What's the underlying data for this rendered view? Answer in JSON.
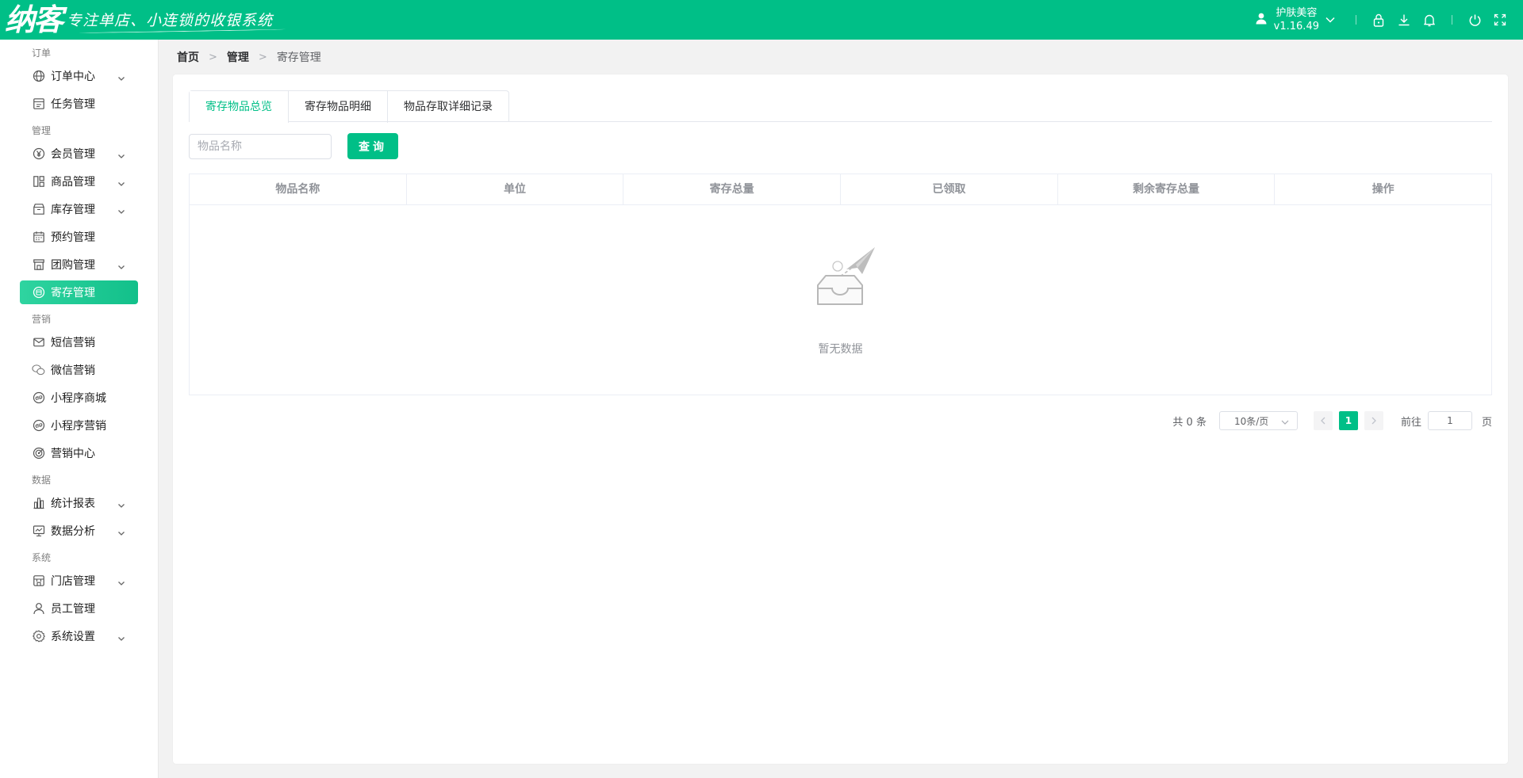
{
  "header": {
    "logo_text": "纳客",
    "slogan": "专注单店、小连锁的收银系统",
    "user_name": "护肤美容",
    "version": "v1.16.49",
    "icons": [
      "user-icon",
      "chevron-down-icon",
      "lock-icon",
      "download-icon",
      "bell-icon",
      "power-icon",
      "fullscreen-icon"
    ]
  },
  "sidebar": {
    "groups": [
      {
        "title": "订单",
        "items": [
          {
            "label": "订单中心",
            "icon": "globe-icon",
            "expandable": true
          },
          {
            "label": "任务管理",
            "icon": "task-icon",
            "expandable": false
          }
        ]
      },
      {
        "title": "管理",
        "items": [
          {
            "label": "会员管理",
            "icon": "yen-icon",
            "expandable": true
          },
          {
            "label": "商品管理",
            "icon": "grid-icon",
            "expandable": true
          },
          {
            "label": "库存管理",
            "icon": "box-icon",
            "expandable": true
          },
          {
            "label": "预约管理",
            "icon": "calendar-icon",
            "expandable": false
          },
          {
            "label": "团购管理",
            "icon": "shop-icon",
            "expandable": true
          },
          {
            "label": "寄存管理",
            "icon": "deposit-icon",
            "expandable": false,
            "active": true
          }
        ]
      },
      {
        "title": "营销",
        "items": [
          {
            "label": "短信营销",
            "icon": "mail-icon",
            "expandable": false
          },
          {
            "label": "微信营销",
            "icon": "wechat-icon",
            "expandable": false
          },
          {
            "label": "小程序商城",
            "icon": "miniapp-icon",
            "expandable": false
          },
          {
            "label": "小程序营销",
            "icon": "miniapp-icon",
            "expandable": false
          },
          {
            "label": "营销中心",
            "icon": "target-icon",
            "expandable": false
          }
        ]
      },
      {
        "title": "数据",
        "items": [
          {
            "label": "统计报表",
            "icon": "bar-chart-icon",
            "expandable": true
          },
          {
            "label": "数据分析",
            "icon": "monitor-icon",
            "expandable": true
          }
        ]
      },
      {
        "title": "系统",
        "items": [
          {
            "label": "门店管理",
            "icon": "store-icon",
            "expandable": true
          },
          {
            "label": "员工管理",
            "icon": "person-icon",
            "expandable": false
          },
          {
            "label": "系统设置",
            "icon": "gear-icon",
            "expandable": true
          }
        ]
      }
    ]
  },
  "breadcrumb": [
    "首页",
    "管理",
    "寄存管理"
  ],
  "tabs": [
    "寄存物品总览",
    "寄存物品明细",
    "物品存取详细记录"
  ],
  "active_tab": 0,
  "search": {
    "placeholder": "物品名称",
    "value": "",
    "button": "查询"
  },
  "table": {
    "columns": [
      "物品名称",
      "单位",
      "寄存总量",
      "已领取",
      "剩余寄存总量",
      "操作"
    ],
    "rows": [],
    "empty_text": "暂无数据"
  },
  "pagination": {
    "total_text": "共 0 条",
    "page_size": "10条/页",
    "current_page": "1",
    "goto_label": "前往",
    "goto_value": "1",
    "page_suffix": "页"
  },
  "colors": {
    "brand": "#00bf87",
    "sidebar_active_start": "#2fd4a0",
    "sidebar_active_end": "#12c08a"
  }
}
